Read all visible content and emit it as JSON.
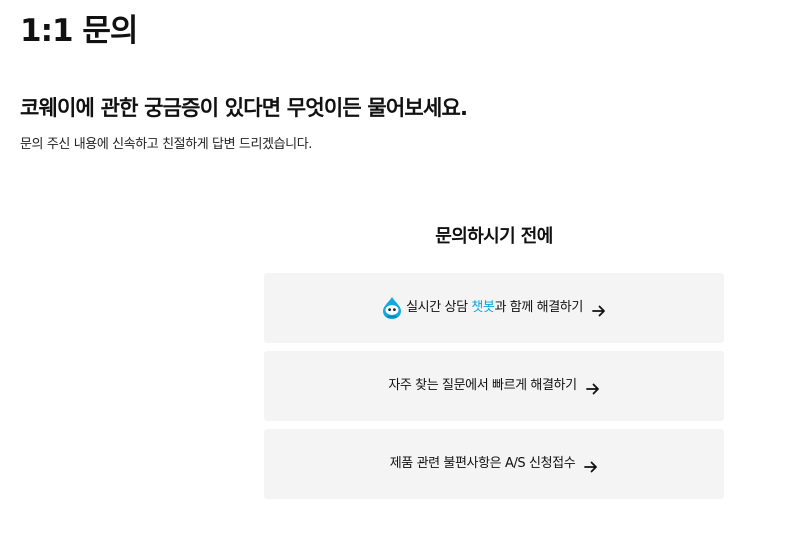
{
  "page": {
    "title": "1:1 문의",
    "headline": "코웨이에 관한 궁금증이 있다면 무엇이든 물어보세요.",
    "subtext": "문의 주신 내용에 신속하고 친절하게 답변 드리겠습니다."
  },
  "before_inquiry": {
    "title": "문의하시기 전에",
    "options": [
      {
        "icon": "chatbot-mascot-icon",
        "text_before": "실시간 상담 ",
        "text_highlight": "챗봇",
        "text_after": "과 함께 해결하기"
      },
      {
        "text": "자주 찾는 질문에서 빠르게 해결하기"
      },
      {
        "text": "제품 관련 불편사항은 A/S 신청접수"
      }
    ],
    "arrow_icon": "arrow-right-icon"
  },
  "colors": {
    "accent": "#0aa5d9",
    "card_background": "#f4f4f5",
    "text": "#111111"
  }
}
